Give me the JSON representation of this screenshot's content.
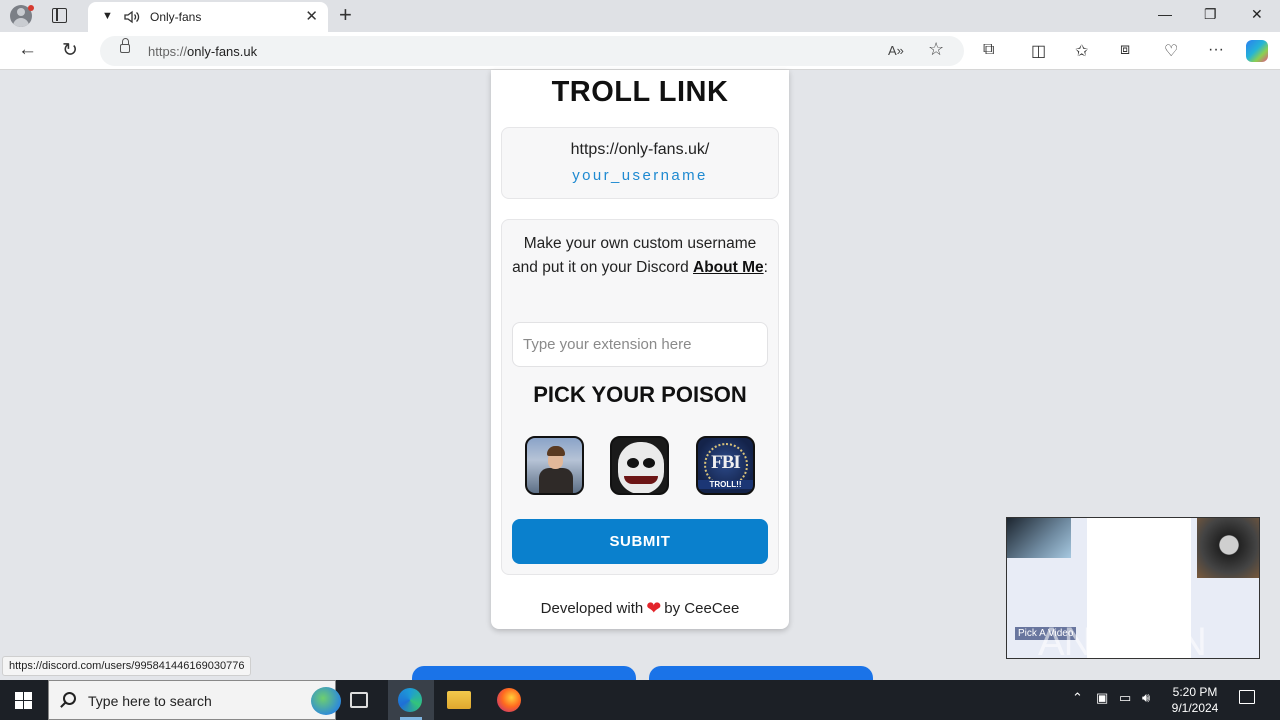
{
  "browser": {
    "tab": {
      "title": "Only-fans"
    },
    "address": {
      "scheme": "https://",
      "host": "only-fans.uk"
    },
    "status_url": "https://discord.com/users/995841446169030776"
  },
  "page": {
    "title": "TROLL LINK",
    "link_preview": {
      "base": "https://only-fans.uk/",
      "username": "your_username"
    },
    "instructions": {
      "text": "Make your own custom username and put it on your Discord",
      "emphasis": "About Me",
      "suffix": ":"
    },
    "extension_input": {
      "placeholder": "Type your extension here",
      "value": ""
    },
    "pick_title": "PICK YOUR POISON",
    "options": [
      {
        "name": "rickroll"
      },
      {
        "name": "jeff"
      },
      {
        "name": "fbi-troll",
        "logo_text": "FBI",
        "badge": "TROLL!!"
      }
    ],
    "submit_label": "SUBMIT",
    "footer": {
      "prefix": "Developed with",
      "suffix": "by CeeCee"
    }
  },
  "overlay": {
    "label": "Pick A Video",
    "watermark": "ANY.RUN"
  },
  "taskbar": {
    "search_placeholder": "Type here to search",
    "time": "5:20 PM",
    "date": "9/1/2024"
  },
  "colors": {
    "accent": "#0a80cd",
    "link": "#1f8ad1",
    "heart": "#e3242b"
  }
}
